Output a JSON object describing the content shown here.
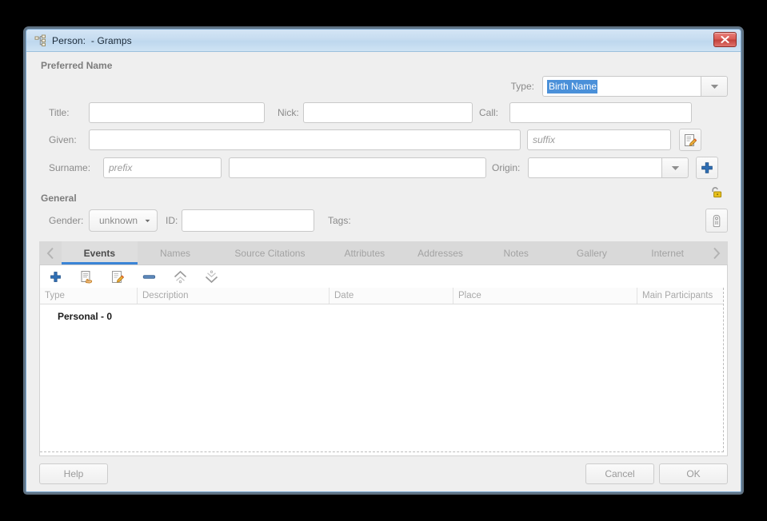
{
  "window": {
    "title": "Person:  - Gramps",
    "app_icon": "person-tree-icon",
    "close_label": "×"
  },
  "preferred_name": {
    "section_title": "Preferred Name",
    "type_label": "Type:",
    "type_value": "Birth Name",
    "type_value_selected": true,
    "title_label": "Title:",
    "title_value": "",
    "nick_label": "Nick:",
    "nick_value": "",
    "call_label": "Call:",
    "call_value": "",
    "given_label": "Given:",
    "given_value": "",
    "suffix_placeholder": "suffix",
    "suffix_value": "",
    "surname_label": "Surname:",
    "prefix_placeholder": "prefix",
    "prefix_value": "",
    "surname_value": "",
    "origin_label": "Origin:",
    "origin_value": "",
    "edit_name_icon": "edit-pencil-icon",
    "add_surname_icon": "plus-icon",
    "type_dropdown_icon": "chevron-down-icon",
    "origin_dropdown_icon": "chevron-down-icon"
  },
  "general": {
    "section_title": "General",
    "privacy_icon": "open-padlock-icon",
    "gender_label": "Gender:",
    "gender_value": "unknown",
    "gender_dropdown_icon": "chevron-down-icon",
    "id_label": "ID:",
    "id_value": "",
    "tags_label": "Tags:",
    "tags_button_icon": "tag-icon"
  },
  "tabs": {
    "scroll_left_icon": "chevron-left-icon",
    "scroll_right_icon": "chevron-right-icon",
    "items": [
      {
        "label": "Events",
        "active": true
      },
      {
        "label": "Names",
        "active": false
      },
      {
        "label": "Source Citations",
        "active": false
      },
      {
        "label": "Attributes",
        "active": false
      },
      {
        "label": "Addresses",
        "active": false
      },
      {
        "label": "Notes",
        "active": false
      },
      {
        "label": "Gallery",
        "active": false
      },
      {
        "label": "Internet",
        "active": false
      }
    ]
  },
  "list_toolbar": {
    "buttons": [
      {
        "name": "add-icon",
        "title": "Add"
      },
      {
        "name": "share-existing-icon",
        "title": "Share an existing event"
      },
      {
        "name": "edit-pencil-icon",
        "title": "Edit"
      },
      {
        "name": "remove-icon",
        "title": "Remove"
      },
      {
        "name": "move-up-icon",
        "title": "Move up"
      },
      {
        "name": "move-down-icon",
        "title": "Move down"
      }
    ]
  },
  "events_list": {
    "columns": [
      "Type",
      "Description",
      "Date",
      "Place",
      "Main Participants"
    ],
    "rows": [
      {
        "label": "Personal - 0",
        "group": true
      }
    ]
  },
  "footer": {
    "help_label": "Help",
    "cancel_label": "Cancel",
    "ok_label": "OK"
  },
  "colors": {
    "accent_blue": "#3b84d6",
    "selection_blue": "#4a90d9",
    "window_border": "#7aa7d0",
    "title_gradient_top": "#d4e5f5",
    "close_red": "#d95b54",
    "label_gray": "#8a8a8a",
    "tab_bar_gray": "#d9d9d9",
    "padlock_yellow": "#e8c11c",
    "body_gray": "#efefef"
  }
}
